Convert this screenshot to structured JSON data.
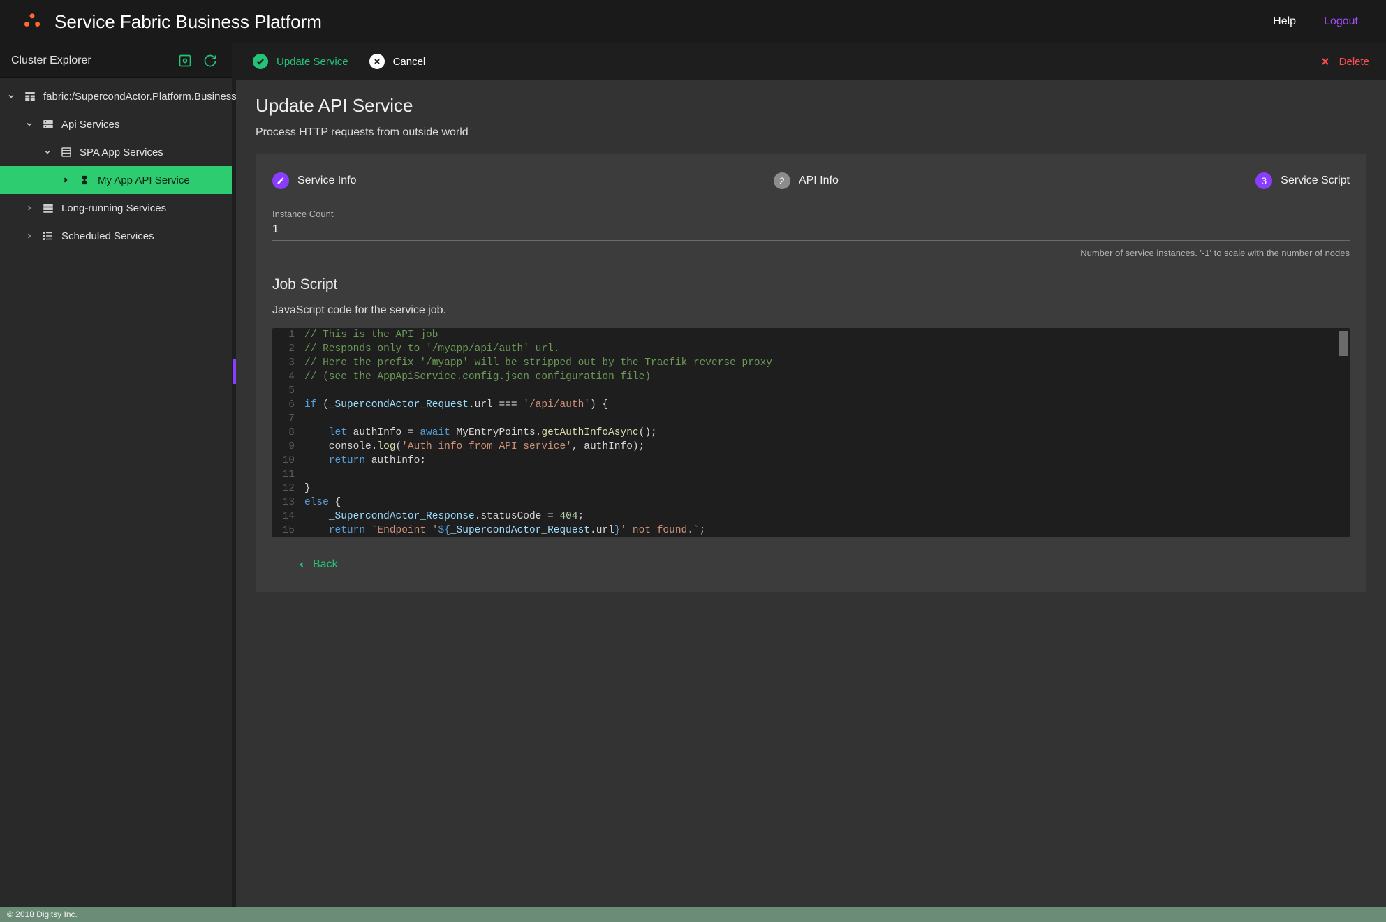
{
  "app": {
    "title": "Service Fabric Business Platform",
    "help": "Help",
    "logout": "Logout"
  },
  "sidebar": {
    "title": "Cluster Explorer",
    "tree": {
      "root": "fabric:/SupercondActor.Platform.Business",
      "api_services": "Api Services",
      "spa_app_services": "SPA App Services",
      "my_app": "My App API Service",
      "long_running": "Long-running Services",
      "scheduled": "Scheduled Services"
    }
  },
  "actions": {
    "update": "Update Service",
    "cancel": "Cancel",
    "delete": "Delete"
  },
  "page": {
    "title": "Update API Service",
    "subtitle": "Process HTTP requests from outside world"
  },
  "stepper": {
    "step1": "Service Info",
    "step2": "API Info",
    "step2_num": "2",
    "step3": "Service Script",
    "step3_num": "3"
  },
  "form": {
    "instance_label": "Instance Count",
    "instance_value": "1",
    "instance_hint": "Number of service instances. '-1' to scale with the number of nodes",
    "script_title": "Job Script",
    "script_desc": "JavaScript code for the service job."
  },
  "code": {
    "l1": "// This is the API job",
    "l2": "// Responds only to '/myapp/api/auth' url.",
    "l3": "// Here the prefix '/myapp' will be stripped out by the Traefik reverse proxy",
    "l4": "// (see the AppApiService.config.json configuration file)",
    "l6a": "if",
    "l6b": " (",
    "l6c": "_SupercondActor_Request",
    "l6d": ".url === ",
    "l6e": "'/api/auth'",
    "l6f": ") {",
    "l8a": "    ",
    "l8b": "let",
    "l8c": " authInfo = ",
    "l8d": "await",
    "l8e": " MyEntryPoints.",
    "l8f": "getAuthInfoAsync",
    "l8g": "();",
    "l9a": "    console.",
    "l9b": "log",
    "l9c": "(",
    "l9d": "'Auth info from API service'",
    "l9e": ", authInfo);",
    "l10a": "    ",
    "l10b": "return",
    "l10c": " authInfo;",
    "l12": "}",
    "l13a": "else",
    "l13b": " {",
    "l14a": "    ",
    "l14b": "_SupercondActor_Response",
    "l14c": ".statusCode = ",
    "l14d": "404",
    "l14e": ";",
    "l15a": "    ",
    "l15b": "return",
    "l15c": " ",
    "l15d": "`Endpoint '",
    "l15e": "${",
    "l15f": "_SupercondActor_Request",
    "l15g": ".url",
    "l15h": "}",
    "l15i": "' not found.`",
    "l15j": ";",
    "l16": "}"
  },
  "back": "Back",
  "footer": "© 2018 Digitsy Inc."
}
